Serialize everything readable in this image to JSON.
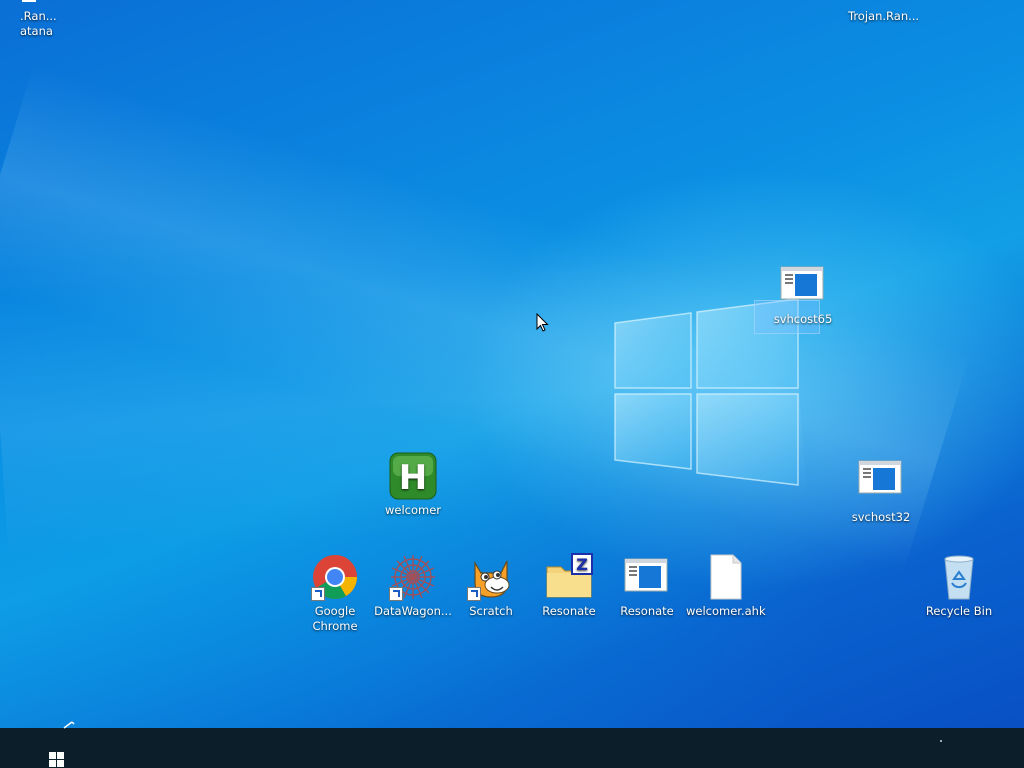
{
  "desktop": {
    "top_left_clipped": {
      "line1": ".Ran...",
      "line2": "atana"
    },
    "top_right_clipped": {
      "label": "Trojan.Ran..."
    },
    "icons": [
      {
        "label": "svhcost65"
      },
      {
        "label": "welcomer"
      },
      {
        "label": "svchost32"
      },
      {
        "label": "Google Chrome"
      },
      {
        "label": "DataWagon..."
      },
      {
        "label": "Scratch"
      },
      {
        "label": "Resonate"
      },
      {
        "label": "Resonate"
      },
      {
        "label": "welcomer.ahk"
      },
      {
        "label": "Recycle Bin"
      }
    ]
  },
  "taskbar": {
    "background": "#0b1e2a",
    "start_icon": "windows-start-icon"
  },
  "colors": {
    "wallpaper_dark": "#0850c4",
    "wallpaper_light": "#129fe6",
    "logo_glow": "#aee6ff"
  }
}
